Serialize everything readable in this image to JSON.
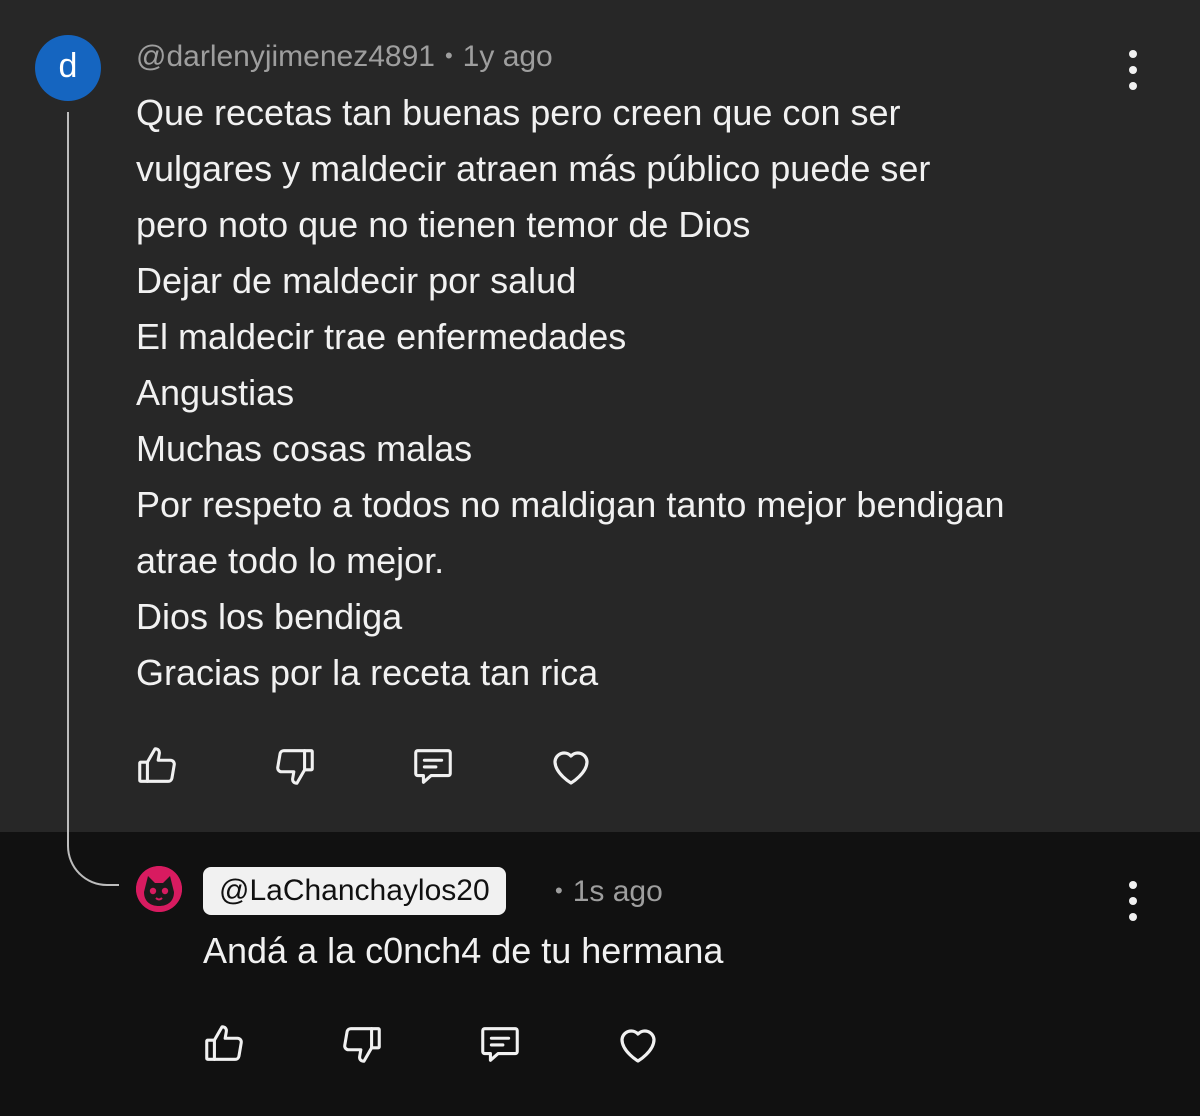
{
  "comment": {
    "avatar_letter": "d",
    "avatar_color": "#1565c0",
    "author": "@darlenyjimenez4891",
    "separator": "•",
    "time": "1y ago",
    "lines": [
      "Que recetas tan buenas pero creen que con ser",
      "vulgares y maldecir  atraen más público puede ser",
      "pero noto que no tienen temor de Dios",
      "Dejar de maldecir por salud",
      "El maldecir trae enfermedades",
      "Angustias",
      "Muchas cosas malas",
      "Por respeto a todos no maldigan tanto mejor bendigan",
      "atrae todo lo mejor.",
      "Dios los bendiga",
      "Gracias por la receta tan rica"
    ],
    "actions": [
      "thumbs-up-icon",
      "thumbs-down-icon",
      "reply-icon",
      "heart-icon"
    ],
    "menu_icon": "more-vertical-icon"
  },
  "reply": {
    "avatar_icon": "cat-avatar-icon",
    "avatar_color": "#d81b60",
    "author": "@LaChanchaylos20",
    "separator": "•",
    "time": "1s ago",
    "text": "Andá a la c0nch4 de tu hermana",
    "actions": [
      "thumbs-up-icon",
      "thumbs-down-icon",
      "reply-icon",
      "heart-icon"
    ],
    "menu_icon": "more-vertical-icon"
  },
  "colors": {
    "top_background": "#272727",
    "reply_background": "#111111",
    "text": "#f1f1f1",
    "meta": "#9e9e9e"
  }
}
